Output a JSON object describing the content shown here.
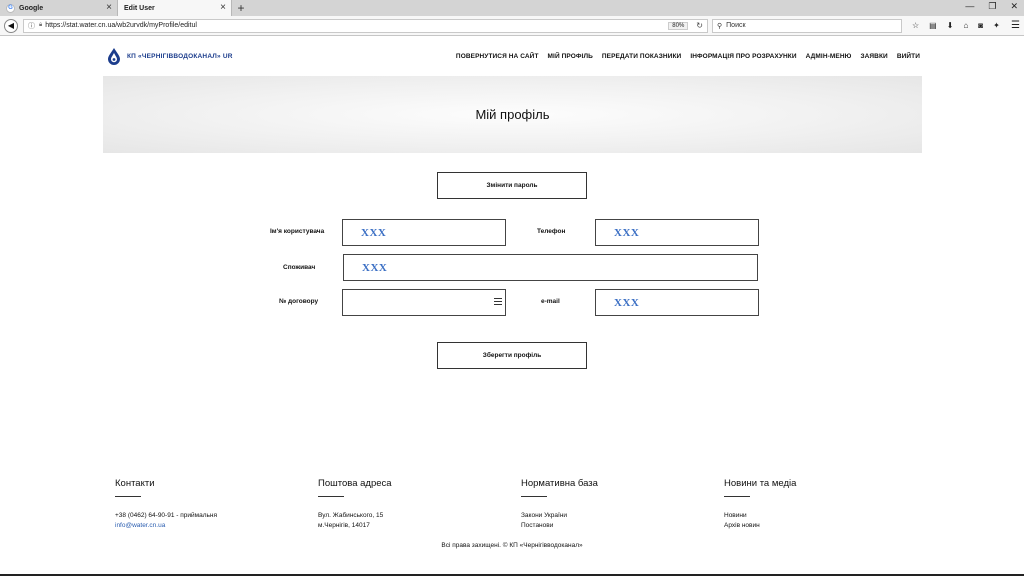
{
  "browser": {
    "tabs": [
      {
        "title": "Google",
        "active": false
      },
      {
        "title": "Edit User",
        "active": true
      }
    ],
    "url": "https://stat.water.cn.ua/wb2urvdk/myProfile/editul",
    "zoom": "80%",
    "search_placeholder": "Поиск"
  },
  "site": {
    "logo_text": "КП «ЧЕРНІГІВВОДОКАНАЛ» UR",
    "nav": [
      "ПОВЕРНУТИСЯ НА САЙТ",
      "МІЙ ПРОФІЛЬ",
      "ПЕРЕДАТИ ПОКАЗНИКИ",
      "ІНФОРМАЦІЯ ПРО РОЗРАХУНКИ",
      "АДМІН-МЕНЮ",
      "ЗАЯВКИ",
      "ВИЙТИ"
    ],
    "brand_color": "#1b3c8c"
  },
  "page": {
    "title": "Мій профіль",
    "change_password_label": "Змінити пароль",
    "save_label": "Зберегти профіль"
  },
  "form": {
    "username": {
      "label": "Ім'я користувача",
      "value": "XXX"
    },
    "phone": {
      "label": "Телефон",
      "value": "XXX"
    },
    "consumer": {
      "label": "Споживач",
      "value": "XXX"
    },
    "contract": {
      "label": "№ договору",
      "value": ""
    },
    "email": {
      "label": "e-mail",
      "value": "XXX"
    }
  },
  "footer": {
    "contacts": {
      "title": "Контакти",
      "lines": [
        "+38 (0462) 64-90-91 - приймальня",
        "info@water.cn.ua"
      ]
    },
    "postal": {
      "title": "Поштова адреса",
      "lines": [
        "Вул. Жабинського, 15",
        "м.Чернігів, 14017"
      ]
    },
    "normative": {
      "title": "Нормативна база",
      "lines": [
        "Закони України",
        "Постанови"
      ]
    },
    "news": {
      "title": "Новини та медіа",
      "lines": [
        "Новини",
        "Архів новин"
      ]
    },
    "copyright": "Всі права захищені. © КП «Чернігівводоканал»"
  }
}
